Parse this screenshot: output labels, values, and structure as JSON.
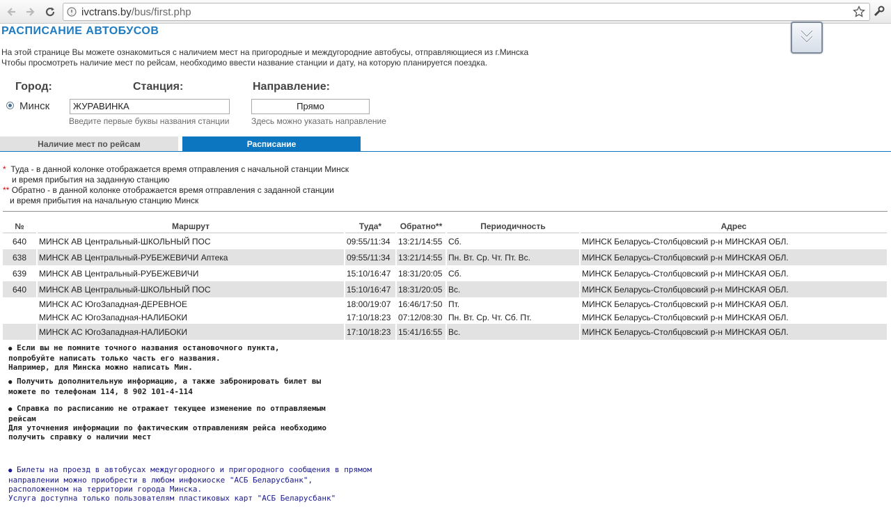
{
  "browser": {
    "url_host": "ivctrans.by",
    "url_path": "/bus/first.php",
    "icons": {
      "back": "back-arrow-icon",
      "forward": "forward-arrow-icon",
      "reload": "reload-icon",
      "site": "globe-icon",
      "bookmark": "star-icon",
      "menu": "wrench-icon"
    }
  },
  "page": {
    "title": "РАСПИСАНИЕ АВТОБУСОВ",
    "intro_line1": "На этой странице Вы можете ознакомиться с наличием мест на пригородные и междугородние автобусы, отправляющиеся из г.Минска",
    "intro_line2": "Чтобы просмотреть наличие мест по рейсам, необходимо ввести название станции и дату, на которую планируется поездка."
  },
  "form": {
    "city_label": "Город:",
    "station_label": "Станция:",
    "direction_label": "Направление:",
    "city_option": "Минск",
    "station_value": "ЖУРАВИНКА",
    "station_hint": "Введите первые буквы названия станции",
    "direction_value": "Прямо",
    "direction_hint": "Здесь можно указать направление"
  },
  "tabs": [
    {
      "label": "Наличие мест по рейсам",
      "active": false
    },
    {
      "label": "Расписание",
      "active": true
    }
  ],
  "notes": {
    "n1_mark": "*",
    "n1_line1": "Туда - в данной колонке отображается время отправления с начальной станции Минск",
    "n1_line2": "и время прибытия на заданную станцию",
    "n2_mark": "**",
    "n2_line1": "Обратно - в данной колонке отображается время отправления с заданной станции",
    "n2_line2": "и время прибытия на начальную станцию Минск"
  },
  "table": {
    "headers": [
      "№",
      "Маршрут",
      "Туда*",
      "Обратно**",
      "Периодичность",
      "Адрес"
    ],
    "rows": [
      {
        "num": "640",
        "route": "МИНСК АВ Центральный-ШКОЛЬНЫЙ ПОС",
        "there": "09:55/11:34",
        "back": "13:21/14:55",
        "period": "Сб.",
        "address": "МИНСК Беларусь-Столбцовский р-н МИНСКАЯ ОБЛ."
      },
      {
        "num": "638",
        "route": "МИНСК АВ Центральный-РУБЕЖЕВИЧИ Аптека",
        "there": "09:55/11:34",
        "back": "13:21/14:55",
        "period": "Пн. Вт. Ср. Чт. Пт. Вс.",
        "address": "МИНСК Беларусь-Столбцовский р-н МИНСКАЯ ОБЛ."
      },
      {
        "num": "639",
        "route": "МИНСК АВ Центральный-РУБЕЖЕВИЧИ",
        "there": "15:10/16:47",
        "back": "18:31/20:05",
        "period": "Сб.",
        "address": "МИНСК Беларусь-Столбцовский р-н МИНСКАЯ ОБЛ."
      },
      {
        "num": "640",
        "route": "МИНСК АВ Центральный-ШКОЛЬНЫЙ ПОС",
        "there": "15:10/16:47",
        "back": "18:31/20:05",
        "period": "Вс.",
        "address": "МИНСК Беларусь-Столбцовский р-н МИНСКАЯ ОБЛ."
      },
      {
        "num": "",
        "route": "МИНСК АС ЮгоЗападная-ДЕРЕВНОЕ",
        "there": "18:00/19:07",
        "back": "16:46/17:50",
        "period": "Пт.",
        "address": "МИНСК Беларусь-Столбцовский р-н МИНСКАЯ ОБЛ."
      },
      {
        "num": "",
        "route": "МИНСК АС ЮгоЗападная-НАЛИБОКИ",
        "there": "17:10/18:23",
        "back": "07:12/08:30",
        "period": "Пн. Вт. Ср. Чт. Сб. Пт.",
        "address": "МИНСК Беларусь-Столбцовский р-н МИНСКАЯ ОБЛ."
      },
      {
        "num": "",
        "route": "МИНСК АС ЮгоЗападная-НАЛИБОКИ",
        "there": "17:10/18:23",
        "back": "15:41/16:55",
        "period": "Вс.",
        "address": "МИНСК Беларусь-Столбцовский р-н МИНСКАЯ ОБЛ."
      }
    ]
  },
  "tips": {
    "t1_l1": "Если вы не помните точного названия остановочного пункта,",
    "t1_l2": "попробуйте написать только часть его названия.",
    "t1_l3": "Например, для Минска можно написать Мин.",
    "t2_l1": "Получить дополнительную информацию, а также забронировать билет вы",
    "t2_l2": "можете по телефонам 114, 8 902 101-4-114",
    "t3_l1": "Справка по расписанию не отражает текущее изменение по отправляемым",
    "t3_l2": "рейсам",
    "t3_l3": "Для уточнения информации по фактическим отправлениям рейса необходимо",
    "t3_l4": "получить справку о наличии мест",
    "t4_l1": "Билеты на проезд в автобусах междугородного и пригородного сообщения в прямом",
    "t4_l2": "направлении можно приобрести в любом инфокиоске \"АСБ Беларусбанк\",",
    "t4_l3": "расположенном на территории города Минска.",
    "t4_l4": "Услуга доступна только пользователям пластиковых карт \"АСБ Беларусбанк\""
  },
  "colors": {
    "accent": "#0c76c0",
    "title": "#1f7bc1",
    "row_shade": "#e2e2e2",
    "note_star": "#d40000"
  }
}
